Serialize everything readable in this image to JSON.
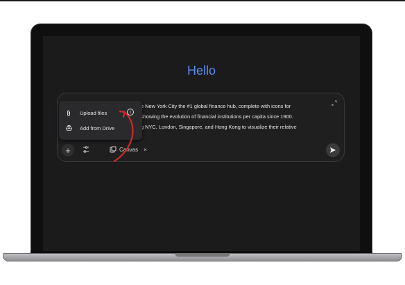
{
  "greeting": "Hello",
  "prompt": {
    "lines": [
      "e New York City the #1 global finance hub, complete with icons for",
      "showing the evolution of financial institutions per capita since 1900.",
      "g NYC, London, Singapore, and Hong Kong to visualize their relative"
    ]
  },
  "menu": {
    "items": [
      {
        "label": "Upload files",
        "icon": "paperclip-icon"
      },
      {
        "label": "Add from Drive",
        "icon": "drive-icon"
      }
    ]
  },
  "toolbar": {
    "canvas_label": "Canvas",
    "close_glyph": "×",
    "plus_glyph": "+"
  },
  "colors": {
    "greeting": "#5b8cf0",
    "annotation_arrow": "#d12b2b",
    "screen_bg": "#1b1b1c"
  }
}
